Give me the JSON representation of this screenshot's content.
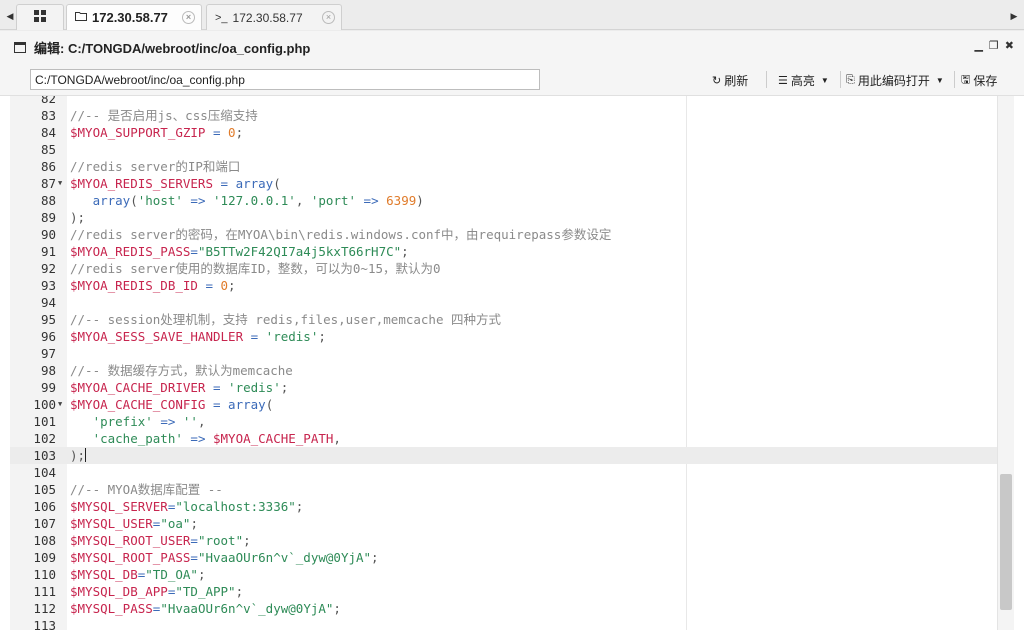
{
  "tabs": [
    {
      "label": "172.30.58.77",
      "icon": "folder-icon",
      "active": true
    },
    {
      "label": "172.30.58.77",
      "icon": "terminal-icon",
      "active": false
    }
  ],
  "window": {
    "title": "编辑: C:/TONGDA/webroot/inc/oa_config.php"
  },
  "toolbar": {
    "path_value": "C:/TONGDA/webroot/inc/oa_config.php",
    "refresh_label": "刷新",
    "highlight_label": "高亮",
    "encoding_label": "用此编码打开",
    "save_label": "保存"
  },
  "editor": {
    "active_line": 103,
    "lines": [
      {
        "n": "82",
        "fold": false,
        "tokens": []
      },
      {
        "n": "83",
        "fold": false,
        "tokens": [
          [
            "c-com",
            "//-- 是否启用js、css压缩支持"
          ]
        ]
      },
      {
        "n": "84",
        "fold": false,
        "tokens": [
          [
            "c-var",
            "$MYOA_SUPPORT_GZIP"
          ],
          [
            "c-op",
            " = "
          ],
          [
            "c-num",
            "0"
          ],
          [
            "",
            ";"
          ]
        ]
      },
      {
        "n": "85",
        "fold": false,
        "tokens": []
      },
      {
        "n": "86",
        "fold": false,
        "tokens": [
          [
            "c-com",
            "//redis server的IP和端口"
          ]
        ]
      },
      {
        "n": "87",
        "fold": true,
        "tokens": [
          [
            "c-var",
            "$MYOA_REDIS_SERVERS"
          ],
          [
            "c-op",
            " = "
          ],
          [
            "c-fn",
            "array"
          ],
          [
            "",
            "("
          ]
        ]
      },
      {
        "n": "88",
        "fold": false,
        "tokens": [
          [
            "",
            "   "
          ],
          [
            "c-fn",
            "array"
          ],
          [
            "",
            "("
          ],
          [
            "c-str",
            "'host'"
          ],
          [
            "c-op",
            " => "
          ],
          [
            "c-str",
            "'127.0.0.1'"
          ],
          [
            "",
            ", "
          ],
          [
            "c-str",
            "'port'"
          ],
          [
            "c-op",
            " => "
          ],
          [
            "c-num",
            "6399"
          ],
          [
            "",
            ")"
          ]
        ]
      },
      {
        "n": "89",
        "fold": false,
        "tokens": [
          [
            "",
            ");"
          ]
        ]
      },
      {
        "n": "90",
        "fold": false,
        "tokens": [
          [
            "c-com",
            "//redis server的密码，在MYOA\\bin\\redis.windows.conf中，由requirepass参数设定"
          ]
        ]
      },
      {
        "n": "91",
        "fold": false,
        "tokens": [
          [
            "c-var",
            "$MYOA_REDIS_PASS"
          ],
          [
            "c-op",
            "="
          ],
          [
            "c-str",
            "\"B5TTw2F42QI7a4j5kxT66rH7C\""
          ],
          [
            "",
            ";"
          ]
        ]
      },
      {
        "n": "92",
        "fold": false,
        "tokens": [
          [
            "c-com",
            "//redis server使用的数据库ID，整数，可以为0~15，默认为0"
          ]
        ]
      },
      {
        "n": "93",
        "fold": false,
        "tokens": [
          [
            "c-var",
            "$MYOA_REDIS_DB_ID"
          ],
          [
            "c-op",
            " = "
          ],
          [
            "c-num",
            "0"
          ],
          [
            "",
            ";"
          ]
        ]
      },
      {
        "n": "94",
        "fold": false,
        "tokens": []
      },
      {
        "n": "95",
        "fold": false,
        "tokens": [
          [
            "c-com",
            "//-- session处理机制，支持 redis,files,user,memcache 四种方式"
          ]
        ]
      },
      {
        "n": "96",
        "fold": false,
        "tokens": [
          [
            "c-var",
            "$MYOA_SESS_SAVE_HANDLER"
          ],
          [
            "c-op",
            " = "
          ],
          [
            "c-str",
            "'redis'"
          ],
          [
            "",
            ";"
          ]
        ]
      },
      {
        "n": "97",
        "fold": false,
        "tokens": []
      },
      {
        "n": "98",
        "fold": false,
        "tokens": [
          [
            "c-com",
            "//-- 数据缓存方式，默认为memcache"
          ]
        ]
      },
      {
        "n": "99",
        "fold": false,
        "tokens": [
          [
            "c-var",
            "$MYOA_CACHE_DRIVER"
          ],
          [
            "c-op",
            " = "
          ],
          [
            "c-str",
            "'redis'"
          ],
          [
            "",
            ";"
          ]
        ]
      },
      {
        "n": "100",
        "fold": true,
        "tokens": [
          [
            "c-var",
            "$MYOA_CACHE_CONFIG"
          ],
          [
            "c-op",
            " = "
          ],
          [
            "c-fn",
            "array"
          ],
          [
            "",
            "("
          ]
        ]
      },
      {
        "n": "101",
        "fold": false,
        "tokens": [
          [
            "",
            "   "
          ],
          [
            "c-str",
            "'prefix'"
          ],
          [
            "c-op",
            " => "
          ],
          [
            "c-str",
            "''"
          ],
          [
            "",
            ","
          ]
        ]
      },
      {
        "n": "102",
        "fold": false,
        "tokens": [
          [
            "",
            "   "
          ],
          [
            "c-str",
            "'cache_path'"
          ],
          [
            "c-op",
            " => "
          ],
          [
            "c-var",
            "$MYOA_CACHE_PATH"
          ],
          [
            "",
            ","
          ]
        ]
      },
      {
        "n": "103",
        "fold": false,
        "tokens": [
          [
            "",
            ");"
          ]
        ]
      },
      {
        "n": "104",
        "fold": false,
        "tokens": []
      },
      {
        "n": "105",
        "fold": false,
        "tokens": [
          [
            "c-com",
            "//-- MYOA数据库配置 --"
          ]
        ]
      },
      {
        "n": "106",
        "fold": false,
        "tokens": [
          [
            "c-var",
            "$MYSQL_SERVER"
          ],
          [
            "c-op",
            "="
          ],
          [
            "c-str",
            "\"localhost:3336\""
          ],
          [
            "",
            ";"
          ]
        ]
      },
      {
        "n": "107",
        "fold": false,
        "tokens": [
          [
            "c-var",
            "$MYSQL_USER"
          ],
          [
            "c-op",
            "="
          ],
          [
            "c-str",
            "\"oa\""
          ],
          [
            "",
            ";"
          ]
        ]
      },
      {
        "n": "108",
        "fold": false,
        "tokens": [
          [
            "c-var",
            "$MYSQL_ROOT_USER"
          ],
          [
            "c-op",
            "="
          ],
          [
            "c-str",
            "\"root\""
          ],
          [
            "",
            ";"
          ]
        ]
      },
      {
        "n": "109",
        "fold": false,
        "tokens": [
          [
            "c-var",
            "$MYSQL_ROOT_PASS"
          ],
          [
            "c-op",
            "="
          ],
          [
            "c-str",
            "\"HvaaOUr6n^v`_dyw@0YjA\""
          ],
          [
            "",
            ";"
          ]
        ]
      },
      {
        "n": "110",
        "fold": false,
        "tokens": [
          [
            "c-var",
            "$MYSQL_DB"
          ],
          [
            "c-op",
            "="
          ],
          [
            "c-str",
            "\"TD_OA\""
          ],
          [
            "",
            ";"
          ]
        ]
      },
      {
        "n": "111",
        "fold": false,
        "tokens": [
          [
            "c-var",
            "$MYSQL_DB_APP"
          ],
          [
            "c-op",
            "="
          ],
          [
            "c-str",
            "\"TD_APP\""
          ],
          [
            "",
            ";"
          ]
        ]
      },
      {
        "n": "112",
        "fold": false,
        "tokens": [
          [
            "c-var",
            "$MYSQL_PASS"
          ],
          [
            "c-op",
            "="
          ],
          [
            "c-str",
            "\"HvaaOUr6n^v`_dyw@0YjA\""
          ],
          [
            "",
            ";"
          ]
        ]
      },
      {
        "n": "113",
        "fold": false,
        "tokens": []
      }
    ]
  },
  "colors": {
    "comment": "#8a8a8a",
    "variable": "#c7254e",
    "string": "#2e8b57",
    "number": "#e07b2a",
    "keyword": "#3b6ab8"
  }
}
